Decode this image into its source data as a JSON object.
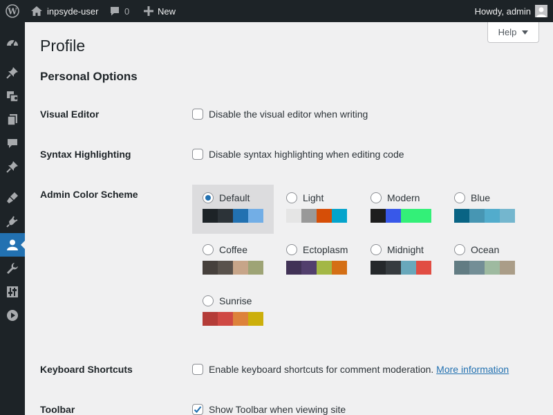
{
  "adminbar": {
    "site_name": "inpsyde-user",
    "comments_count": "0",
    "new_label": "New",
    "howdy": "Howdy, admin"
  },
  "sidebar": {
    "items": [
      {
        "icon": "dashboard-icon"
      },
      {
        "icon": "pin-icon"
      },
      {
        "icon": "media-icon"
      },
      {
        "icon": "pages-icon"
      },
      {
        "icon": "comments-icon"
      },
      {
        "icon": "pin-icon"
      },
      {
        "icon": "appearance-icon"
      },
      {
        "icon": "plugins-icon"
      },
      {
        "icon": "users-icon",
        "current": true
      },
      {
        "icon": "tools-icon"
      },
      {
        "icon": "settings-icon"
      },
      {
        "icon": "play-icon"
      }
    ]
  },
  "help": {
    "label": "Help"
  },
  "page": {
    "title": "Profile",
    "section_title": "Personal Options"
  },
  "visual_editor": {
    "label": "Visual Editor",
    "option": "Disable the visual editor when writing",
    "checked": false
  },
  "syntax": {
    "label": "Syntax Highlighting",
    "option": "Disable syntax highlighting when editing code",
    "checked": false
  },
  "color_scheme": {
    "label": "Admin Color Scheme",
    "schemes": [
      {
        "name": "Default",
        "selected": true,
        "colors": [
          "#1d2327",
          "#2c3338",
          "#2271b1",
          "#72aee6"
        ]
      },
      {
        "name": "Light",
        "selected": false,
        "colors": [
          "#e5e5e5",
          "#999999",
          "#d64e07",
          "#04a4cc"
        ]
      },
      {
        "name": "Modern",
        "selected": false,
        "colors": [
          "#1e1e1e",
          "#3858e9",
          "#33f078",
          "#33f078"
        ]
      },
      {
        "name": "Blue",
        "selected": false,
        "colors": [
          "#096484",
          "#4796b3",
          "#52accc",
          "#74b6ce"
        ]
      },
      {
        "name": "Coffee",
        "selected": false,
        "colors": [
          "#46403c",
          "#59524c",
          "#c7a589",
          "#9ea476"
        ]
      },
      {
        "name": "Ectoplasm",
        "selected": false,
        "colors": [
          "#413256",
          "#523f6d",
          "#a3b745",
          "#d46f15"
        ]
      },
      {
        "name": "Midnight",
        "selected": false,
        "colors": [
          "#25282b",
          "#363b3f",
          "#69a8bb",
          "#e14d43"
        ]
      },
      {
        "name": "Ocean",
        "selected": false,
        "colors": [
          "#627c83",
          "#738e96",
          "#9ebaa0",
          "#aa9d88"
        ]
      },
      {
        "name": "Sunrise",
        "selected": false,
        "colors": [
          "#b43c38",
          "#cf4944",
          "#dd823b",
          "#ccaf0b"
        ]
      }
    ]
  },
  "keyboard": {
    "label": "Keyboard Shortcuts",
    "option": "Enable keyboard shortcuts for comment moderation.",
    "link": "More information",
    "checked": false
  },
  "toolbar": {
    "label": "Toolbar",
    "option": "Show Toolbar when viewing site",
    "checked": true
  }
}
